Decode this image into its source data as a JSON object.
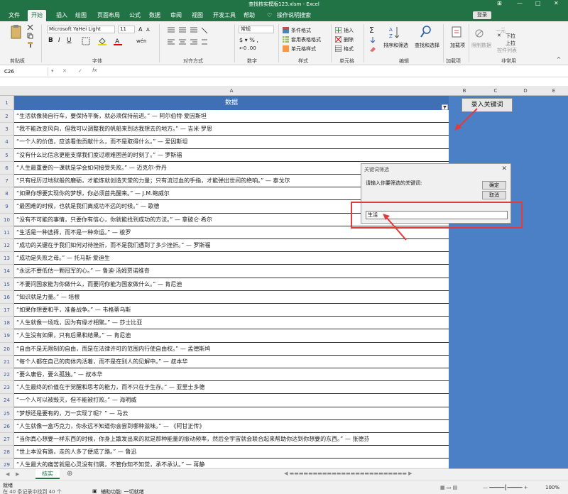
{
  "title": "查找核实模版123.xlsm  -  Excel",
  "login": "登录",
  "tabs": [
    "文件",
    "开始",
    "插入",
    "绘图",
    "页面布局",
    "公式",
    "数据",
    "审阅",
    "视图",
    "开发工具",
    "帮助",
    "操作说明搜索"
  ],
  "ribbon": {
    "clipboard": "剪贴板",
    "font_name": "Microsoft YaHei Light",
    "font_size": "11",
    "font_group": "字体",
    "align_group": "对齐方式",
    "number_format": "常规",
    "number_group": "数字",
    "style_items": [
      "条件格式",
      "套用表格格式",
      "单元格样式"
    ],
    "style_group": "样式",
    "cell_items": [
      "插入",
      "删除",
      "格式"
    ],
    "cell_group": "单元格",
    "edit_items": [
      "排序和筛选",
      "查找和选择"
    ],
    "edit_group": "编辑",
    "addin": "加载项",
    "addin_group": "加载项",
    "unusual": [
      "下拉",
      "上拉",
      "限制数据",
      "一元",
      "控件列表"
    ],
    "unusual_group": "非常用"
  },
  "formula": {
    "cell_ref": "C26",
    "value": ""
  },
  "columns": [
    "A",
    "B",
    "C",
    "D",
    "E"
  ],
  "header_label": "数据",
  "button_label": "录入关键词",
  "rows": [
    {
      "n": "2",
      "text": "“生活就像骑自行车，要保持平衡，就必须保持前进。” — 阿尔伯特·爱因斯坦"
    },
    {
      "n": "3",
      "text": "“我不能改变风向，但我可以调整我的帆船来到达我想去的地方。” — 吉米·罗恩"
    },
    {
      "n": "4",
      "text": "“一个人的价值，应该看他贡献什么，而不是取得什么。” — 爱因斯坦"
    },
    {
      "n": "5",
      "text": "“没有什么比信念更能支撑我们度过艰难困苦的时刻了。” — 罗斯福"
    },
    {
      "n": "6",
      "text": "“人生最重要的一课就是学会如何接受失败。” — 迈克尔·乔丹"
    },
    {
      "n": "7",
      "text": "“只有经历过地狱般的磨砺，才能炼就创造天堂的力量；只有流过血的手指，才能弹出世间的绝响。” — 泰戈尔"
    },
    {
      "n": "8",
      "text": "“如果你想要实现你的梦想，你必须首先醒来。” — J.M.鲍威尔"
    },
    {
      "n": "9",
      "text": "“最困难的时候，也就是我们离成功不远的时候。” — 歌德"
    },
    {
      "n": "10",
      "text": "“没有不可能的事情，只要你有信心，你就能找到成功的方法。” — 拿破仑·希尔"
    },
    {
      "n": "11",
      "text": "“生活是一种选择，而不是一种命运。” — 梭罗"
    },
    {
      "n": "12",
      "text": "“成功的关键在于我们如何对待挫折，而不是我们遇到了多少挫折。” — 罗斯福"
    },
    {
      "n": "13",
      "text": "“成功是失败之母。” — 托马斯·爱迪生"
    },
    {
      "n": "14",
      "text": "“永远不要低估一颗冠军的心。” — 鲁迪·汤姆贾诺维奇"
    },
    {
      "n": "15",
      "text": "“不要问国家能为你做什么，而要问你能为国家做什么。” — 肯尼迪"
    },
    {
      "n": "16",
      "text": "“知识就是力量。” — 培根"
    },
    {
      "n": "17",
      "text": "“如果你想要和平，准备战争。” — 韦格蒂乌斯"
    },
    {
      "n": "18",
      "text": "“人生就像一场戏，因为有缘才相聚。” — 莎士比亚"
    },
    {
      "n": "19",
      "text": "“人生没有如果，只有后果和结果。” — 肯尼迪"
    },
    {
      "n": "20",
      "text": "“自由不是无限制的自由，而是在法律许可的范围内行使自由权。” — 孟德斯鸠"
    },
    {
      "n": "21",
      "text": "“每个人都在自己的肉体内活着，而不是在别人的见解中。” — 叔本华"
    },
    {
      "n": "22",
      "text": "“要么庸俗，要么孤独。” — 叔本华"
    },
    {
      "n": "23",
      "text": "“人生最终的价值在于觉醒和思考的能力，而不只在于生存。” — 亚里士多德"
    },
    {
      "n": "24",
      "text": "“一个人可以被毁灭，但不能被打败。” — 海明威"
    },
    {
      "n": "25",
      "text": "“梦想还是要有的，万一实现了呢？” — 马云"
    },
    {
      "n": "26",
      "text": "“人生就像一盒巧克力，你永远不知道你会尝到哪种滋味。” — 《阿甘正传》"
    },
    {
      "n": "27",
      "text": "“当你真心想要一样东西的时候，你身上散发出来的就是那种能量的振动频率，然后全宇宙就会联合起来帮助你达到你想要的东西。” — 张德芬"
    },
    {
      "n": "28",
      "text": "“世上本没有路，走的人多了便成了路。” — 鲁迅"
    },
    {
      "n": "29",
      "text": "“人生最大的痛苦就是心灵没有归属，不管你知不知觉，承不承认。” — 蒋静"
    }
  ],
  "dialog": {
    "title": "关键词筛选",
    "prompt": "请输入你要筛选的关键词:",
    "ok": "确定",
    "cancel": "取消",
    "input_value": "生活",
    "close": "✕"
  },
  "sheet_tab": "核实",
  "status": {
    "mode": "就绪",
    "found": "在 40 条记录中找到 40 个",
    "accessibility": "辅助功能: 一切就绪",
    "zoom": "100%"
  },
  "colors": {
    "excel_green": "#217346",
    "header_blue": "#3f6fb5",
    "area_blue": "#4b80c6",
    "annotation_red": "#e23b3b"
  }
}
